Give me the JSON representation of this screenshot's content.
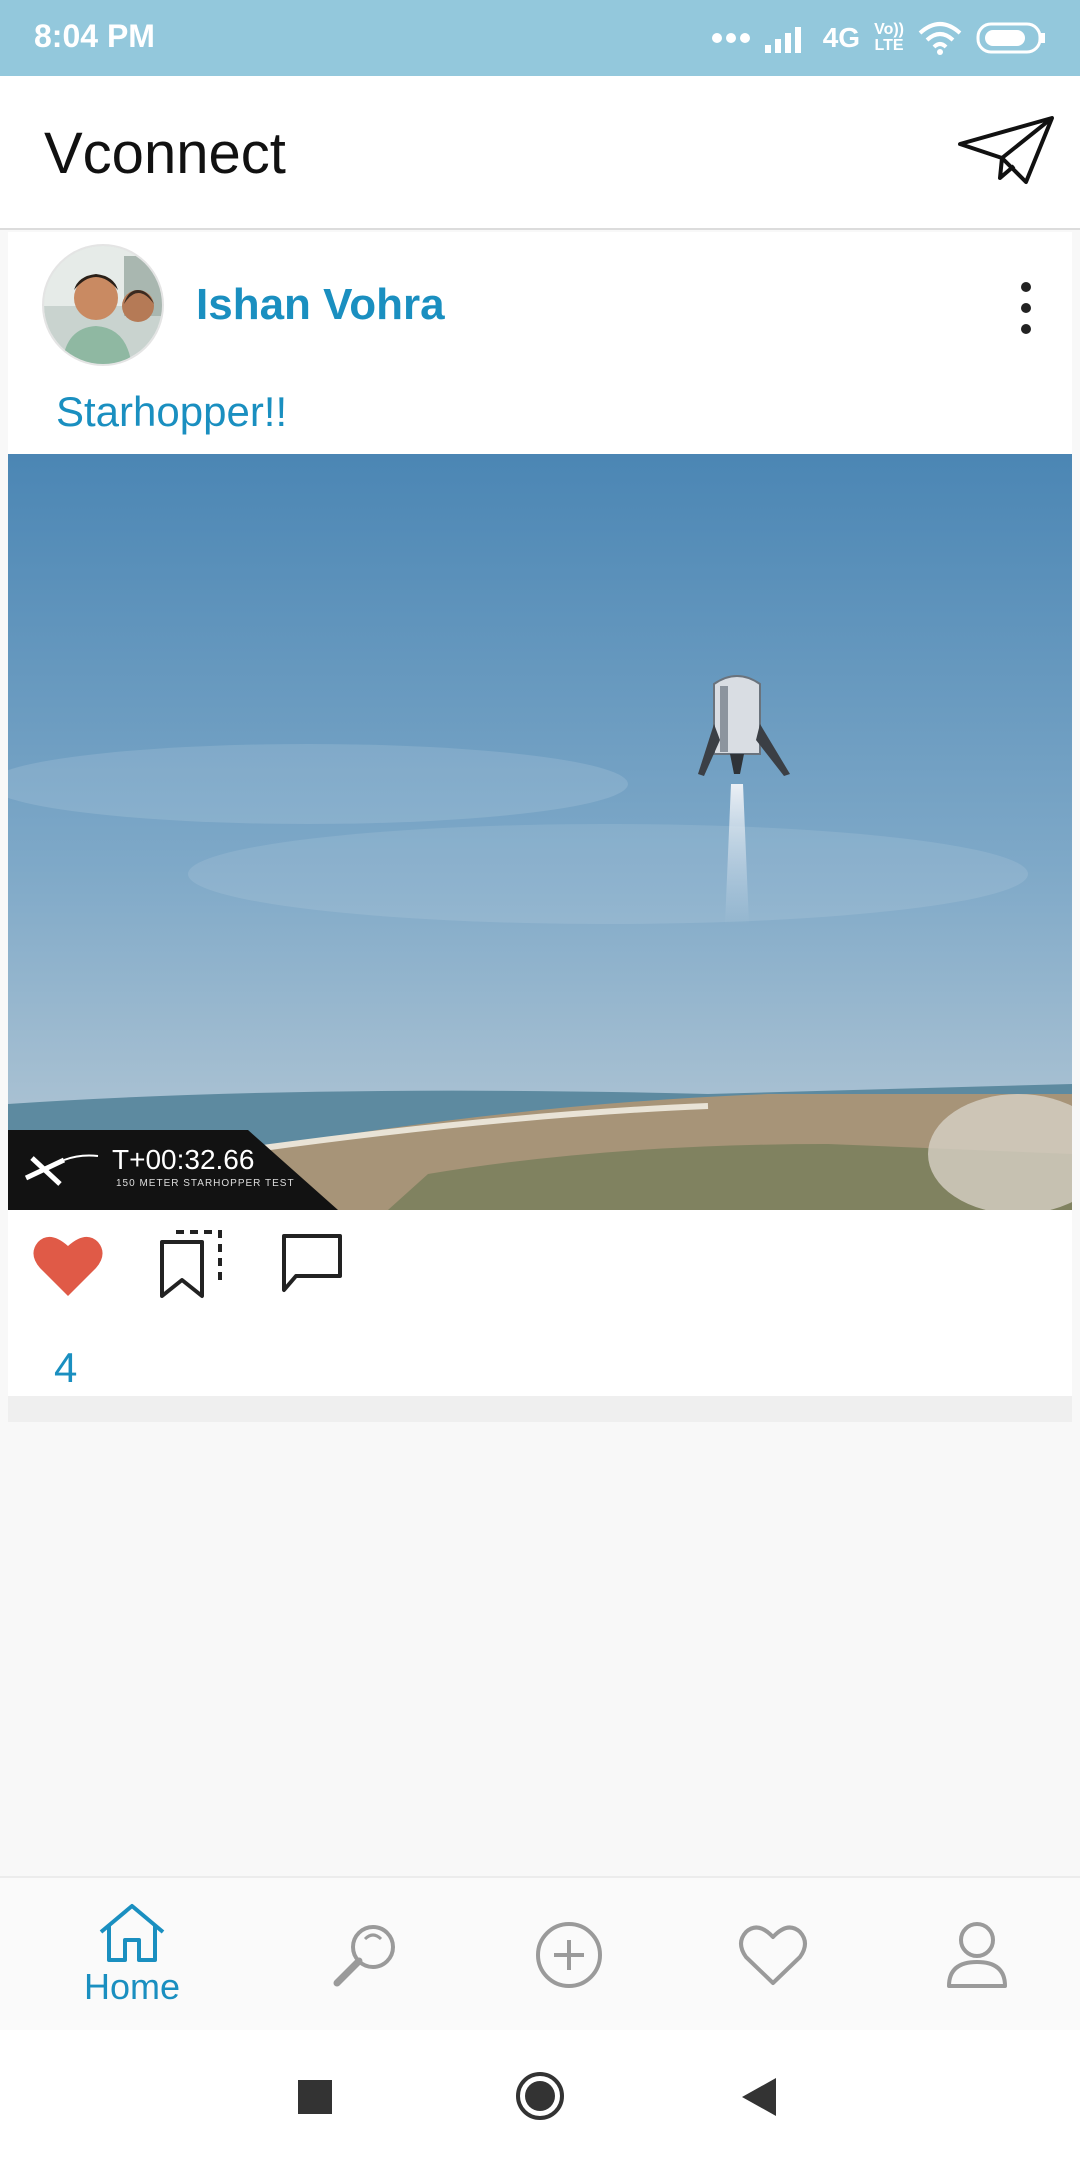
{
  "status_bar": {
    "time": "8:04 PM",
    "network": "4G",
    "volte_line1": "Vo))",
    "volte_line2": "LTE",
    "icons": [
      "dots-icon",
      "signal-icon",
      "wifi-icon",
      "battery-icon"
    ]
  },
  "app_bar": {
    "title": "Vconnect",
    "send_icon": "paper-plane-icon"
  },
  "post": {
    "author": "Ishan Vohra",
    "caption": "Starhopper!!",
    "image_description_icon": "rocket-photo",
    "overlay": {
      "timer": "T+00:32.66",
      "subtitle": "150 METER STARHOPPER TEST"
    },
    "likes": "4",
    "like_color": "#e05a47"
  },
  "bottom_nav": {
    "items": [
      {
        "label": "Home",
        "icon": "home-icon",
        "active": true
      },
      {
        "label": "",
        "icon": "search-icon",
        "active": false
      },
      {
        "label": "",
        "icon": "add-icon",
        "active": false
      },
      {
        "label": "",
        "icon": "heart-icon",
        "active": false
      },
      {
        "label": "",
        "icon": "profile-icon",
        "active": false
      }
    ]
  },
  "colors": {
    "accent": "#1a8fc0",
    "status_bar": "#93c8dc"
  }
}
